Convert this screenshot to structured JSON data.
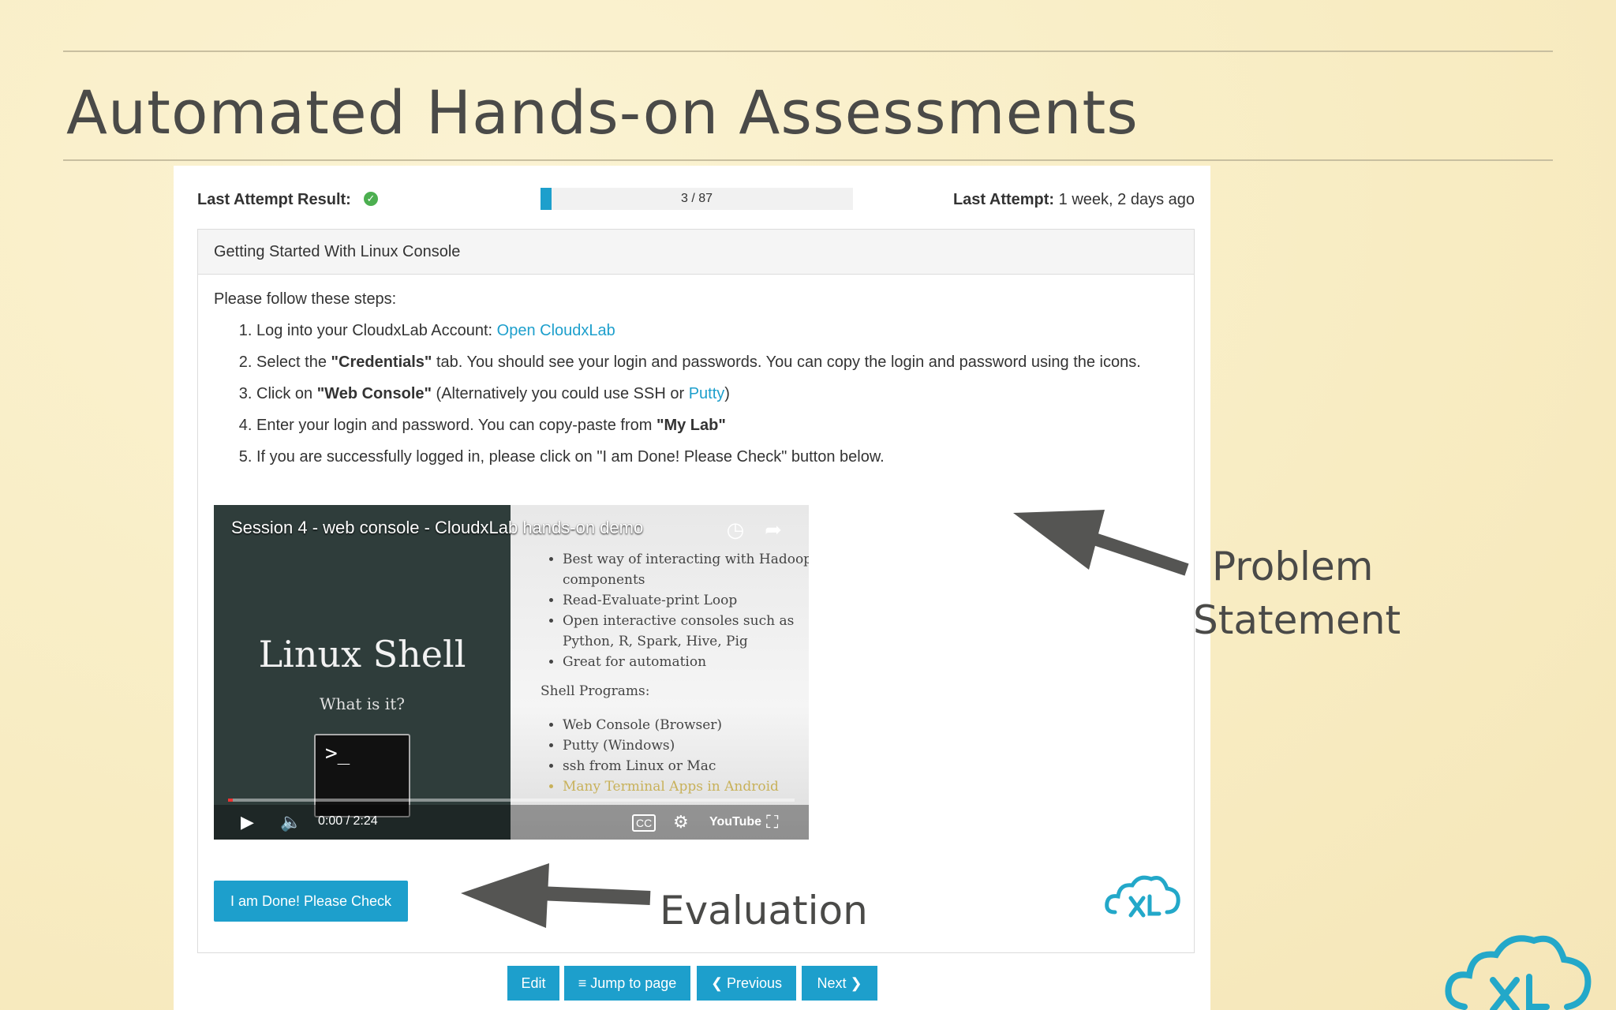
{
  "slide": {
    "title": "Automated Hands-on Assessments"
  },
  "topbar": {
    "last_attempt_result_label": "Last Attempt Result:",
    "progress_text": "3 / 87",
    "progress_fraction": 0.0345,
    "last_attempt_label": "Last Attempt:",
    "last_attempt_value": "1 week, 2 days ago"
  },
  "card": {
    "header": "Getting Started With Linux Console",
    "intro": "Please follow these steps:",
    "steps": {
      "s1_text": "Log into your CloudxLab Account: ",
      "s1_link": "Open CloudxLab",
      "s2_pre": "Select the ",
      "s2_bold": "\"Credentials\"",
      "s2_post": " tab. You should see your login and passwords. You can copy the login and password using the icons.",
      "s3_pre": "Click on ",
      "s3_bold": "\"Web Console\"",
      "s3_mid": " (Alternatively you could use SSH or ",
      "s3_link": "Putty",
      "s3_post": ")",
      "s4_pre": "Enter your login and password. You can copy-paste from ",
      "s4_bold": "\"My Lab\"",
      "s5_text": "If you are successfully logged in, please click on \"I am Done! Please Check\" button below."
    },
    "done_button": "I am Done! Please Check"
  },
  "video": {
    "title": "Session 4 - web console - CloudxLab hands-on demo",
    "shell_title": "Linux Shell",
    "shell_subtitle": "What is it?",
    "terminal_prompt": ">_",
    "bullets": [
      "Best way of interacting with Hadoop components",
      "Read-Evaluate-print Loop",
      "Open interactive consoles such as Python, R, Spark, Hive, Pig",
      "Great for automation"
    ],
    "shell_programs_label": "Shell Programs:",
    "programs": [
      "Web Console (Browser)",
      "Putty  (Windows)",
      "ssh from Linux or Mac",
      "Many Terminal Apps in Android"
    ],
    "time": "0:00 / 2:24",
    "cc_label": "CC",
    "youtube_label": "YouTube"
  },
  "nav": {
    "edit": "Edit",
    "jump": "≡ Jump to page",
    "previous": "❮ Previous",
    "next": "Next ❯"
  },
  "annotations": {
    "problem_line1": "Problem",
    "problem_line2": "Statement",
    "evaluation": "Evaluation"
  },
  "colors": {
    "accent": "#1d9fcc",
    "background": "#f9efc8",
    "annotation": "#4a4a48"
  }
}
